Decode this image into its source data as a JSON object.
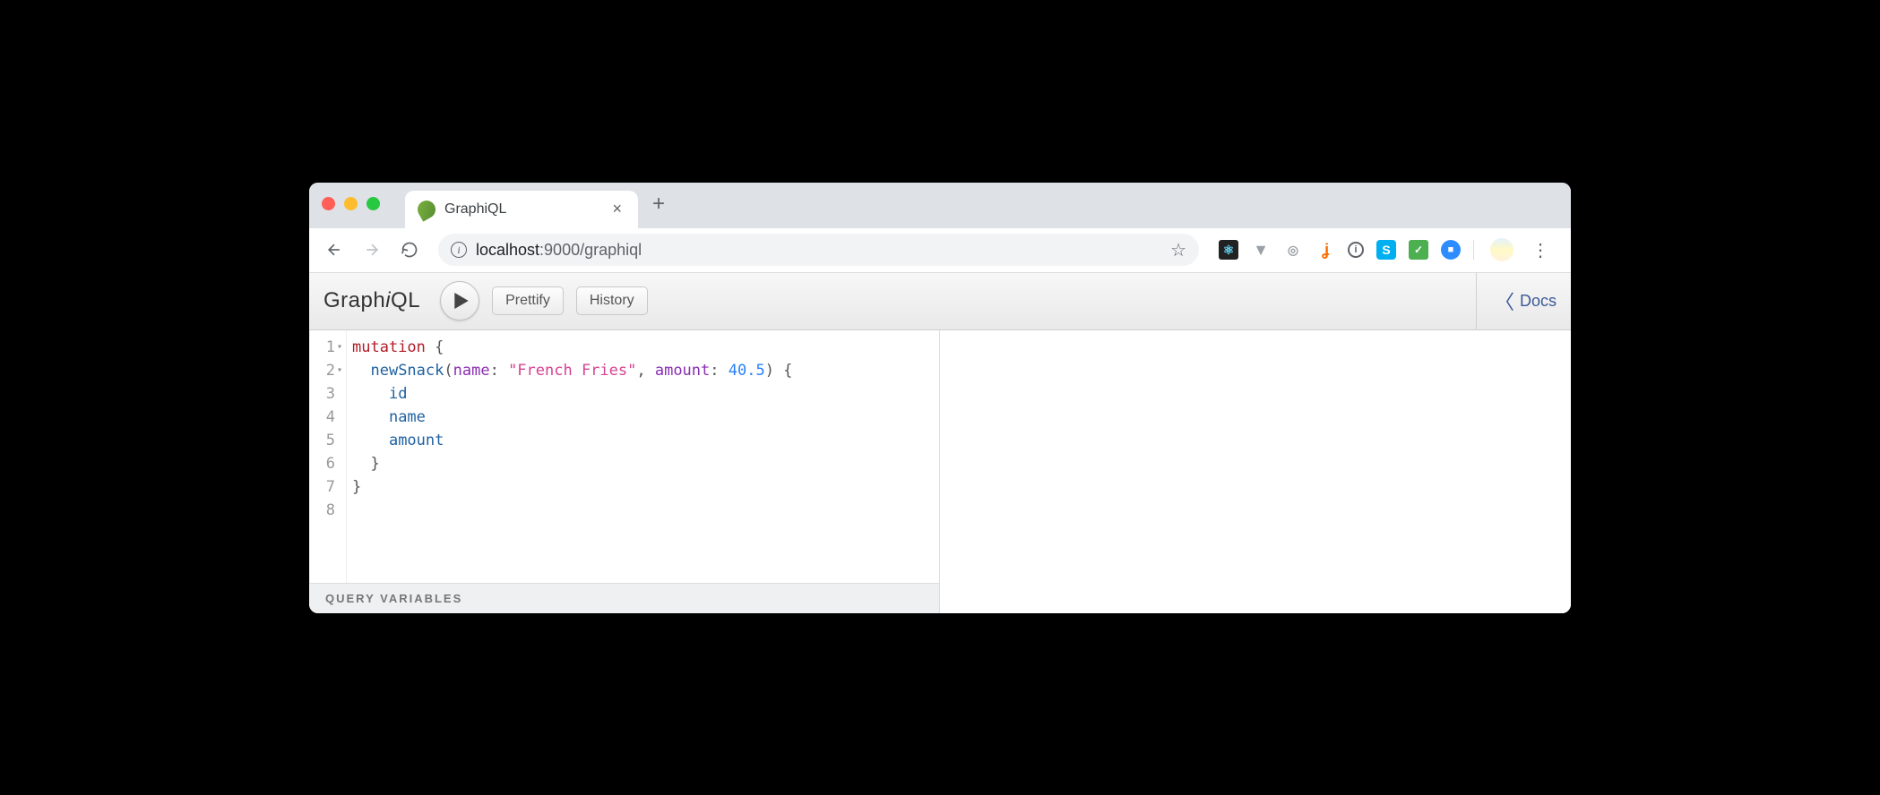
{
  "browser": {
    "tab": {
      "title": "GraphiQL"
    },
    "url_full": "localhost:9000/graphiql",
    "url_host": "localhost",
    "url_port_path": ":9000/graphiql"
  },
  "graphiql": {
    "logo_prefix": "Graph",
    "logo_i": "i",
    "logo_suffix": "QL",
    "toolbar": {
      "prettify": "Prettify",
      "history": "History"
    },
    "docs": "Docs",
    "variables_label": "QUERY VARIABLES"
  },
  "editor": {
    "line_numbers": [
      "1",
      "2",
      "3",
      "4",
      "5",
      "6",
      "7",
      "8"
    ],
    "tokens": [
      [
        {
          "t": "keyword",
          "v": "mutation"
        },
        {
          "t": "punc",
          "v": " {"
        }
      ],
      [
        {
          "t": "punc",
          "v": "  "
        },
        {
          "t": "field",
          "v": "newSnack"
        },
        {
          "t": "punc",
          "v": "("
        },
        {
          "t": "attr",
          "v": "name"
        },
        {
          "t": "punc",
          "v": ": "
        },
        {
          "t": "string",
          "v": "\"French Fries\""
        },
        {
          "t": "punc",
          "v": ", "
        },
        {
          "t": "attr",
          "v": "amount"
        },
        {
          "t": "punc",
          "v": ": "
        },
        {
          "t": "number",
          "v": "40.5"
        },
        {
          "t": "punc",
          "v": ") {"
        }
      ],
      [
        {
          "t": "punc",
          "v": "    "
        },
        {
          "t": "field",
          "v": "id"
        }
      ],
      [
        {
          "t": "punc",
          "v": "    "
        },
        {
          "t": "field",
          "v": "name"
        }
      ],
      [
        {
          "t": "punc",
          "v": "    "
        },
        {
          "t": "field",
          "v": "amount"
        }
      ],
      [
        {
          "t": "punc",
          "v": "  }"
        }
      ],
      [
        {
          "t": "punc",
          "v": "}"
        }
      ],
      []
    ],
    "fold_lines": [
      1,
      2
    ]
  }
}
